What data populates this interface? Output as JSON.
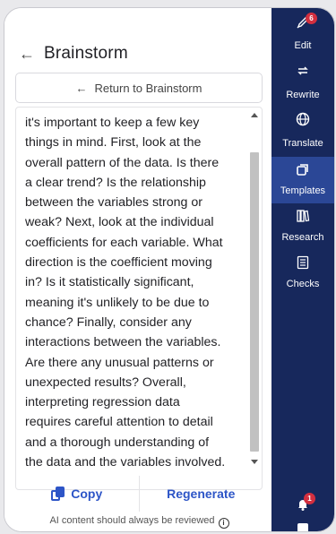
{
  "header": {
    "title": "Brainstorm"
  },
  "return_button": {
    "label": "Return to Brainstorm"
  },
  "content": {
    "lines": [
      "it's important to keep a few key",
      "things in mind. First, look at the",
      "overall pattern of the data. Is there",
      "a clear trend? Is the relationship",
      "between the variables strong or",
      "weak? Next, look at the individual",
      "coefficients for each variable. What",
      "direction is the coefficient moving",
      "in? Is it statistically significant,",
      "meaning it's unlikely to be due to",
      "chance? Finally, consider any",
      "interactions between the variables.",
      "Are there any unusual patterns or",
      "unexpected results? Overall,",
      "interpreting regression data",
      "requires careful attention to detail",
      "and a thorough understanding of",
      "the data and the variables involved."
    ]
  },
  "actions": {
    "copy_label": "Copy",
    "regenerate_label": "Regenerate"
  },
  "footer": {
    "note": "AI content should always be reviewed"
  },
  "rail": {
    "top_badge": "6",
    "items": [
      {
        "label": "Edit",
        "icon": "pencil-icon"
      },
      {
        "label": "Rewrite",
        "icon": "rewrite-arrows-icon"
      },
      {
        "label": "Translate",
        "icon": "globe-icon"
      },
      {
        "label": "Templates",
        "icon": "templates-icon",
        "active": true
      },
      {
        "label": "Research",
        "icon": "books-icon"
      },
      {
        "label": "Checks",
        "icon": "checklist-icon"
      }
    ],
    "bell_badge": "1"
  },
  "colors": {
    "rail_bg": "#17285c",
    "rail_active": "#2b4796",
    "accent": "#2d55c7",
    "badge": "#d32f3f"
  }
}
